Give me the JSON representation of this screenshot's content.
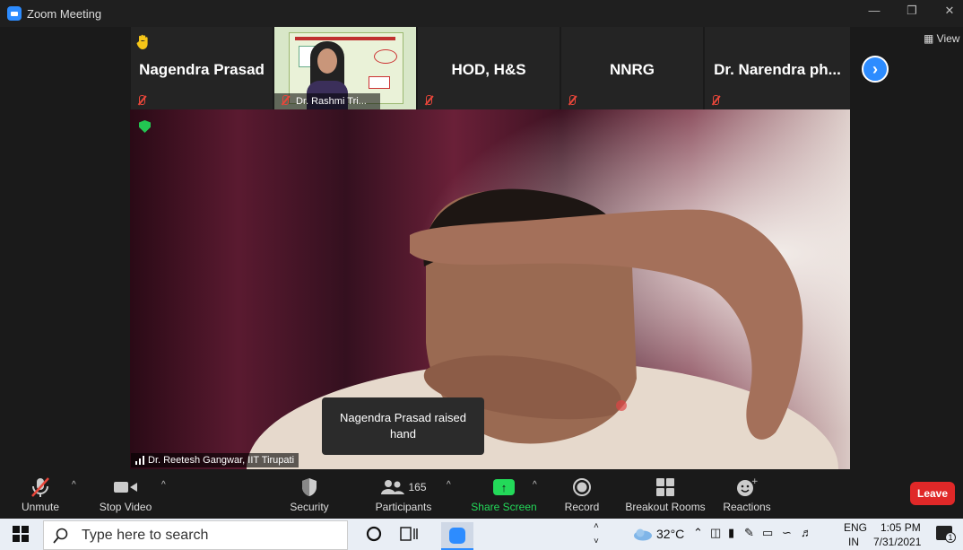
{
  "window": {
    "title": "Zoom Meeting"
  },
  "gallery": {
    "tiles": [
      {
        "name": "Nagendra Prasad",
        "hand": true
      },
      {
        "name": "Dr. Rashmi Tri..."
      },
      {
        "name": "HOD, H&S"
      },
      {
        "name": "NNRG"
      },
      {
        "name": "Dr. Narendra ph..."
      }
    ],
    "view_label": "View"
  },
  "main": {
    "speaker": "Dr. Reetesh Gangwar, IIT Tirupati",
    "toast": "Nagendra Prasad raised hand"
  },
  "controls": {
    "unmute": "Unmute",
    "stop_video": "Stop Video",
    "security": "Security",
    "participants": "Participants",
    "participants_count": "165",
    "share_screen": "Share Screen",
    "record": "Record",
    "breakout_rooms": "Breakout Rooms",
    "reactions": "Reactions",
    "leave": "Leave"
  },
  "taskbar": {
    "search_placeholder": "Type here to search",
    "temperature": "32°C",
    "lang_top": "ENG",
    "lang_bottom": "IN",
    "time": "1:05 PM",
    "date": "7/31/2021",
    "notification_count": "1"
  },
  "colors": {
    "accent": "#2d8cff",
    "leave": "#e02828",
    "share": "#23d959",
    "mute": "#e8463a"
  }
}
